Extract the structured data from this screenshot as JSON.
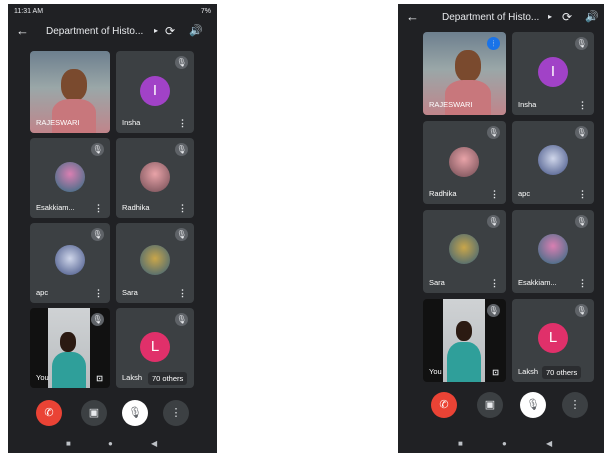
{
  "left": {
    "status": {
      "time": "11:31 AM",
      "indicators": "7%"
    },
    "title": "Department of Histo...",
    "tiles": [
      {
        "name": "RAJESWARI"
      },
      {
        "name": "Insha",
        "initial": "I",
        "color": "#a142c7"
      },
      {
        "name": "Esakkiam..."
      },
      {
        "name": "Radhika"
      },
      {
        "name": "apc"
      },
      {
        "name": "Sara"
      },
      {
        "name": "You"
      },
      {
        "name": "Laksh",
        "initial": "L",
        "color": "#e0306a"
      }
    ],
    "others": "70 others"
  },
  "right": {
    "title": "Department of Histo...",
    "tiles": [
      {
        "name": "RAJESWARI"
      },
      {
        "name": "Insha",
        "initial": "I",
        "color": "#a142c7"
      },
      {
        "name": "Radhika"
      },
      {
        "name": "apc"
      },
      {
        "name": "Sara"
      },
      {
        "name": "Esakkiam..."
      },
      {
        "name": "You"
      },
      {
        "name": "Laksh",
        "initial": "L",
        "color": "#e0306a"
      }
    ],
    "others": "70 others"
  },
  "icons": {
    "back": "arrow-left-icon",
    "title_chevron": "chevron-right-icon",
    "switch_camera": "switch-camera-icon",
    "speaker": "speaker-icon",
    "mic_off": "mic-off-icon",
    "more": "more-vert-icon",
    "end_call": "end-call-icon",
    "camera": "camera-icon",
    "mic_toggle": "mic-off-icon",
    "options": "more-vert-icon"
  },
  "colors": {
    "background": "#202124",
    "tile": "#3c4043",
    "end_call": "#ea4335"
  }
}
